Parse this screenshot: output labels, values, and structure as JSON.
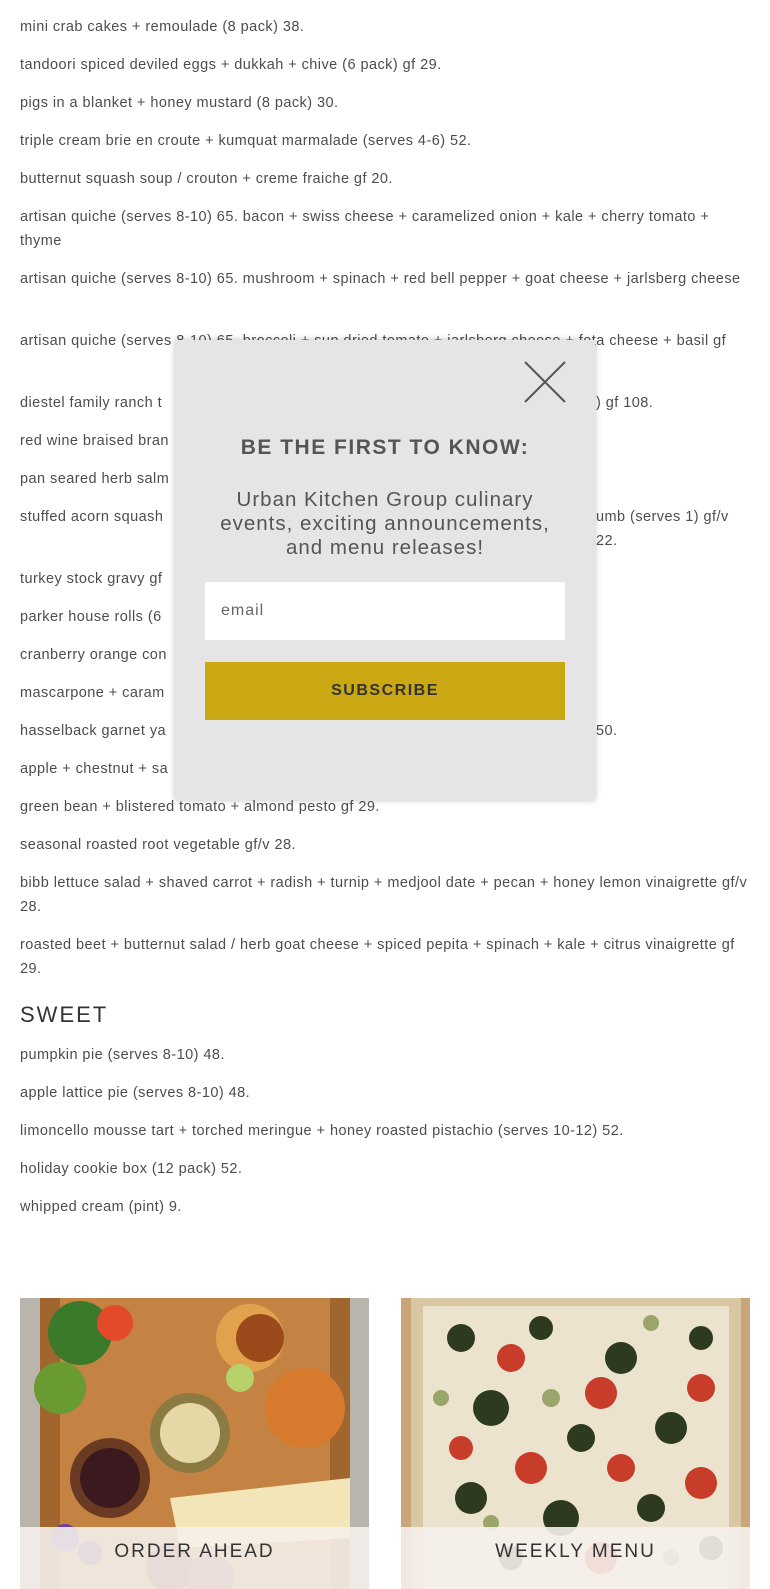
{
  "menu": {
    "items": [
      "mini crab cakes + remoulade (8 pack) 38.",
      "tandoori spiced deviled eggs + dukkah + chive (6 pack) gf 29.",
      "pigs in a blanket + honey mustard (8 pack) 30.",
      "triple cream brie en croute + kumquat marmalade (serves 4-6) 52.",
      "butternut squash soup / crouton + creme fraiche gf 20.",
      "artisan quiche (serves 8-10) 65. bacon + swiss cheese + caramelized onion + kale + cherry tomato + thyme",
      "artisan quiche (serves 8-10) 65. mushroom + spinach + red bell pepper + goat cheese + jarlsberg cheese",
      "artisan quiche (serves 8-10) 65. broccoli + sun dried tomato + jarlsberg cheese + feta cheese + basil gf",
      "diestel family ranch t",
      ") gf 108.",
      "red wine braised bran",
      "pan seared herb salm",
      "stuffed acorn squash",
      "umb (serves 1) gf/v 22.",
      "turkey stock gravy gf",
      "parker house rolls (6",
      "cranberry orange con",
      "mascarpone + caram",
      "hasselback garnet ya",
      "50.",
      "apple + chestnut + sa",
      "green bean + blistered tomato + almond pesto gf 29.",
      "seasonal roasted root vegetable gf/v 28.",
      "bibb lettuce salad + shaved carrot + radish + turnip + medjool date + pecan + honey lemon vinaigrette gf/v 28.",
      "roasted beet + butternut salad / herb goat cheese + spiced pepita + spinach + kale + citrus vinaigrette gf 29."
    ]
  },
  "sweet": {
    "heading": "SWEET",
    "items": [
      "pumpkin pie (serves 8-10) 48.",
      "apple lattice pie (serves 8-10) 48.",
      "limoncello mousse tart + torched meringue + honey roasted pistachio (serves 10-12) 52.",
      "holiday cookie box (12 pack) 52.",
      "whipped cream (pint) 9."
    ]
  },
  "cards": [
    {
      "label": "ORDER AHEAD"
    },
    {
      "label": "WEEKLY MENU"
    }
  ],
  "modal": {
    "title": "BE THE FIRST TO KNOW:",
    "subtitle": "Urban Kitchen Group culinary events, exciting announcements, and menu releases!",
    "email_placeholder": "email",
    "subscribe_label": "SUBSCRIBE",
    "close_icon": "close-icon"
  },
  "colors": {
    "accent": "#c9a814",
    "modal_bg": "#e5e5e5"
  }
}
